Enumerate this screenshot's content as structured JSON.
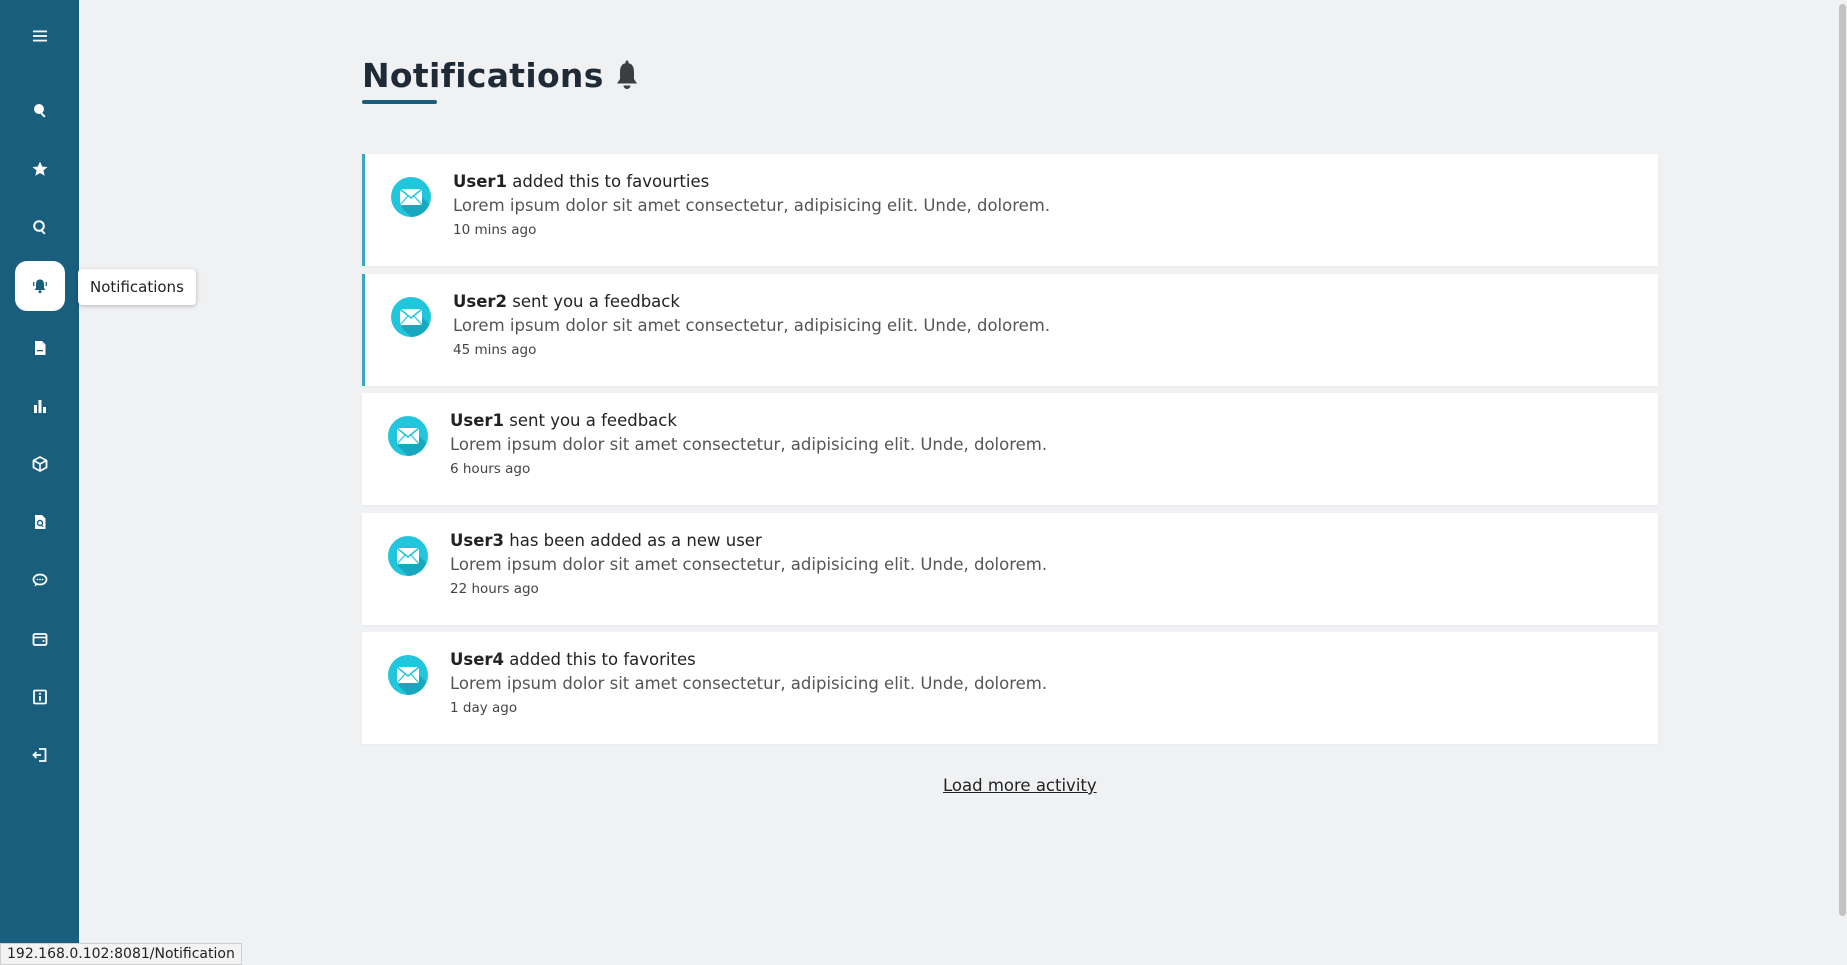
{
  "sidebar": {
    "items": [
      {
        "icon": "hamburger-menu-icon",
        "active": false
      },
      {
        "icon": "search-icon",
        "active": false
      },
      {
        "icon": "star-icon",
        "active": false
      },
      {
        "icon": "zoom-search-icon",
        "active": false
      },
      {
        "icon": "bell-icon",
        "active": true
      },
      {
        "icon": "document-icon",
        "active": false
      },
      {
        "icon": "bar-chart-icon",
        "active": false
      },
      {
        "icon": "box-icon",
        "active": false
      },
      {
        "icon": "file-search-icon",
        "active": false
      },
      {
        "icon": "chat-icon",
        "active": false
      },
      {
        "icon": "wallet-icon",
        "active": false
      },
      {
        "icon": "info-icon",
        "active": false
      },
      {
        "icon": "logout-icon",
        "active": false
      }
    ],
    "tooltip": "Notifications",
    "background": "#195e7d"
  },
  "page": {
    "title": "Notifications",
    "title_icon": "bell-icon",
    "accent": "#195e7d"
  },
  "notifications": [
    {
      "user": "User1",
      "action": " added this to favourties",
      "body": "Lorem ipsum dolor sit amet consectetur, adipisicing elit. Unde, dolorem.",
      "time": "10 mins ago",
      "unread": true
    },
    {
      "user": "User2",
      "action": " sent you a feedback",
      "body": "Lorem ipsum dolor sit amet consectetur, adipisicing elit. Unde, dolorem.",
      "time": "45 mins ago",
      "unread": true
    },
    {
      "user": "User1",
      "action": " sent you a feedback",
      "body": "Lorem ipsum dolor sit amet consectetur, adipisicing elit. Unde, dolorem.",
      "time": "6 hours ago",
      "unread": false
    },
    {
      "user": "User3",
      "action": " has been added as a new user",
      "body": "Lorem ipsum dolor sit amet consectetur, adipisicing elit. Unde, dolorem.",
      "time": "22 hours ago",
      "unread": false
    },
    {
      "user": "User4",
      "action": " added this to favorites",
      "body": "Lorem ipsum dolor sit amet consectetur, adipisicing elit. Unde, dolorem.",
      "time": "1 day ago",
      "unread": false
    }
  ],
  "load_more": "Load more activity",
  "status_url": "192.168.0.102:8081/Notification",
  "colors": {
    "unread_border": "#3aa7c7",
    "mail_icon": "#21c6dd"
  }
}
